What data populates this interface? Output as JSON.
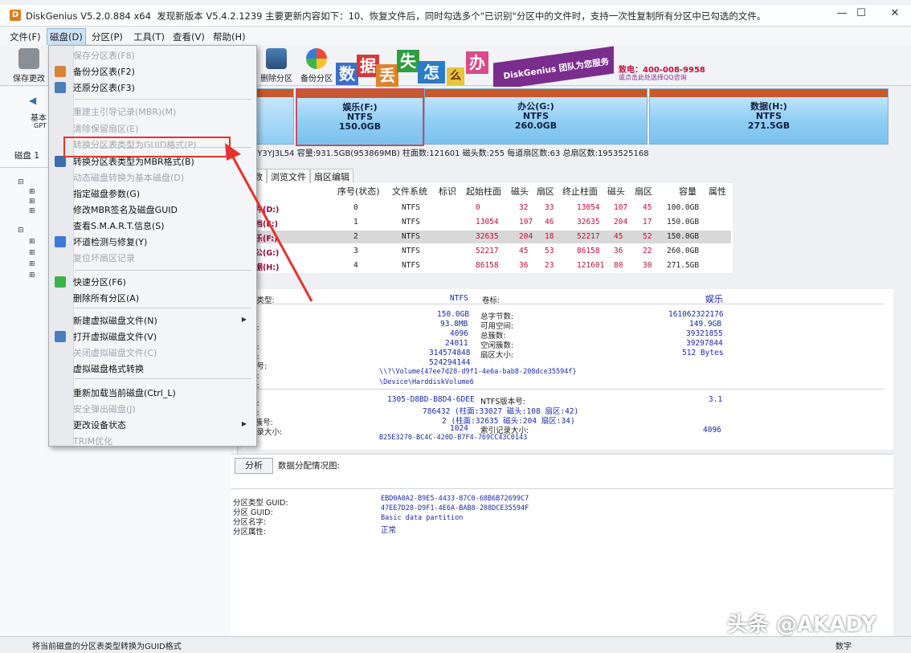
{
  "window": {
    "title": "DiskGenius V5.2.0.884 x64",
    "update_notice": "发现新版本 V5.4.2.1239 主要更新内容如下：10、恢复文件后，同时勾选多个\"已识别\"分区中的文件时，支持一次性复制所有分区中已勾选的文件。",
    "controls": {
      "minimize": "—",
      "maximize": "☐",
      "close": "✕"
    }
  },
  "menubar": [
    "文件(F)",
    "磁盘(D)",
    "分区(P)",
    "工具(T)",
    "查看(V)",
    "帮助(H)"
  ],
  "toolbar": {
    "save_label": "保存更改",
    "delete_partition": "删除分区",
    "backup_partition": "备份分区"
  },
  "banner": {
    "chars": [
      "数",
      "据",
      "丢",
      "失",
      "怎",
      "么",
      "办"
    ],
    "brand": "DiskGenius 团队为您服务",
    "phone": "致电：400-008-9958",
    "qq": "或点击此处选择QQ咨询"
  },
  "left_panel": {
    "basic": "基本",
    "gpt": "GPT",
    "disk_label": "磁盘 1"
  },
  "partitions": [
    {
      "name": "娱乐(F:)",
      "fs": "NTFS",
      "size": "150.0GB"
    },
    {
      "name": "办公(G:)",
      "fs": "NTFS",
      "size": "260.0GB"
    },
    {
      "name": "数据(H:)",
      "fs": "NTFS",
      "size": "271.5GB"
    }
  ],
  "disk_info": "CC6Y3YJ3L54  容量:931.5GB(953869MB)  柱面数:121601  磁头数:255  每道扇区数:63  总扇区数:1953525168",
  "tabs": [
    "参数",
    "浏览文件",
    "扇区编辑"
  ],
  "table": {
    "headers": [
      "序号(状态)",
      "文件系统",
      "标识",
      "起始柱面",
      "磁头",
      "扇区",
      "终止柱面",
      "磁头",
      "扇区",
      "容量",
      "属性"
    ],
    "rows": [
      {
        "name": "软件(D:)",
        "idx": "0",
        "fs": "NTFS",
        "sc": "0",
        "sh": "32",
        "ss": "33",
        "ec": "13054",
        "eh": "107",
        "es": "45",
        "cap": "100.0GB"
      },
      {
        "name": "文档(E:)",
        "idx": "1",
        "fs": "NTFS",
        "sc": "13054",
        "sh": "107",
        "ss": "46",
        "ec": "32635",
        "eh": "204",
        "es": "17",
        "cap": "150.0GB"
      },
      {
        "name": "娱乐(F:)",
        "idx": "2",
        "fs": "NTFS",
        "sc": "32635",
        "sh": "204",
        "ss": "18",
        "ec": "52217",
        "eh": "45",
        "es": "52",
        "cap": "150.0GB"
      },
      {
        "name": "办公(G:)",
        "idx": "3",
        "fs": "NTFS",
        "sc": "52217",
        "sh": "45",
        "ss": "53",
        "ec": "86158",
        "eh": "36",
        "es": "22",
        "cap": "260.0GB"
      },
      {
        "name": "数据(H:)",
        "idx": "4",
        "fs": "NTFS",
        "sc": "86158",
        "sh": "36",
        "ss": "23",
        "ec": "121601",
        "eh": "80",
        "es": "30",
        "cap": "271.5GB"
      }
    ]
  },
  "props": {
    "fs_type_label": "统类型:",
    "fs_type": "NTFS",
    "vol_label": "卷标:",
    "vol": "娱乐",
    "total_bytes_label": "总字节数:",
    "total_bytes": "161062322176",
    "free_label": "可用空间:",
    "free": "149.9GB",
    "total_clusters_label": "总簇数:",
    "total_clusters": "39321855",
    "free_clusters_label": "空闲簇数:",
    "free_clusters": "39297844",
    "sector_size_label": "扇区大小:",
    "sector_size": "512 Bytes",
    "capacity": "150.0GB",
    "used": "93.8MB",
    "cluster_size": "4096",
    "used_clusters": "24011",
    "total_sectors": "314574848",
    "start_sector": "524294144",
    "volume_path": "\\\\?\\Volume{47ee7d28-d9f1-4e6a-bab8-208dce35594f}",
    "device_path": "\\Device\\HarddiskVolume6",
    "serial": "1305-D8BD-B8D4-6DEE",
    "ntfs_ver_label": "NTFS版本号:",
    "ntfs_ver": "3.1",
    "mft_line": "786432 (柱面:33027 磁头:108 扇区:42)",
    "mftmirr_line": "2 (柱面:32635 磁头:204 扇区:34)",
    "record_size": "1024",
    "index_record_label": "索引记录大小:",
    "index_record": "4096",
    "guid": "B25E3270-BC4C-420D-B7F4-769CC43C0143",
    "frag_labels": [
      "间:",
      "数:",
      "数:",
      "区号:",
      "径:",
      "径:",
      "号:",
      "号:",
      "rr簇号:",
      "记录大小:"
    ]
  },
  "analysis": {
    "button": "分析",
    "label": "数据分配情况图:",
    "guid_type_label": "分区类型 GUID:",
    "guid_type": "EBD0A0A2-B9E5-4433-87C0-68B6B72699C7",
    "guid_part_label": "分区 GUID:",
    "guid_part": "47EE7D28-D9F1-4E6A-BAB8-208DCE35594F",
    "name_label": "分区名字:",
    "name": "Basic data partition",
    "attr_label": "分区属性:",
    "attr": "正常"
  },
  "dropdown": [
    {
      "label": "保存分区表(F8)",
      "disabled": true
    },
    {
      "label": "备份分区表(F2)",
      "disabled": false
    },
    {
      "label": "还原分区表(F3)",
      "disabled": false
    },
    {
      "label": "重建主引导记录(MBR)(M)",
      "disabled": true
    },
    {
      "label": "清除保留扇区(E)",
      "disabled": true
    },
    {
      "label": "转换分区表类型为GUID格式(P)",
      "disabled": true
    },
    {
      "label": "转换分区表类型为MBR格式(B)",
      "disabled": false
    },
    {
      "label": "动态磁盘转换为基本磁盘(D)",
      "disabled": true
    },
    {
      "label": "指定磁盘参数(G)",
      "disabled": false
    },
    {
      "label": "修改MBR签名及磁盘GUID",
      "disabled": false
    },
    {
      "label": "查看S.M.A.R.T.信息(S)",
      "disabled": false
    },
    {
      "label": "坏道检测与修复(Y)",
      "disabled": false
    },
    {
      "label": "复位坏扇区记录",
      "disabled": true
    },
    {
      "label": "快速分区(F6)",
      "disabled": false
    },
    {
      "label": "删除所有分区(A)",
      "disabled": false
    },
    {
      "label": "新建虚拟磁盘文件(N)",
      "disabled": false
    },
    {
      "label": "打开虚拟磁盘文件(V)",
      "disabled": false
    },
    {
      "label": "关闭虚拟磁盘文件(C)",
      "disabled": true
    },
    {
      "label": "虚拟磁盘格式转换",
      "disabled": false
    },
    {
      "label": "重新加载当前磁盘(Ctrl_L)",
      "disabled": false
    },
    {
      "label": "安全弹出磁盘(J)",
      "disabled": true
    },
    {
      "label": "更改设备状态",
      "disabled": false
    },
    {
      "label": "TRIM优化",
      "disabled": true
    }
  ],
  "statusbar": {
    "left": "将当前磁盘的分区表类型转换为GUID格式",
    "right": "数字"
  },
  "watermark": "头条 @AKADY",
  "colors": {
    "highlight_red": "#e8312f",
    "partition_blue": "#8fcdf3",
    "text_blue": "#1a2aa8"
  }
}
